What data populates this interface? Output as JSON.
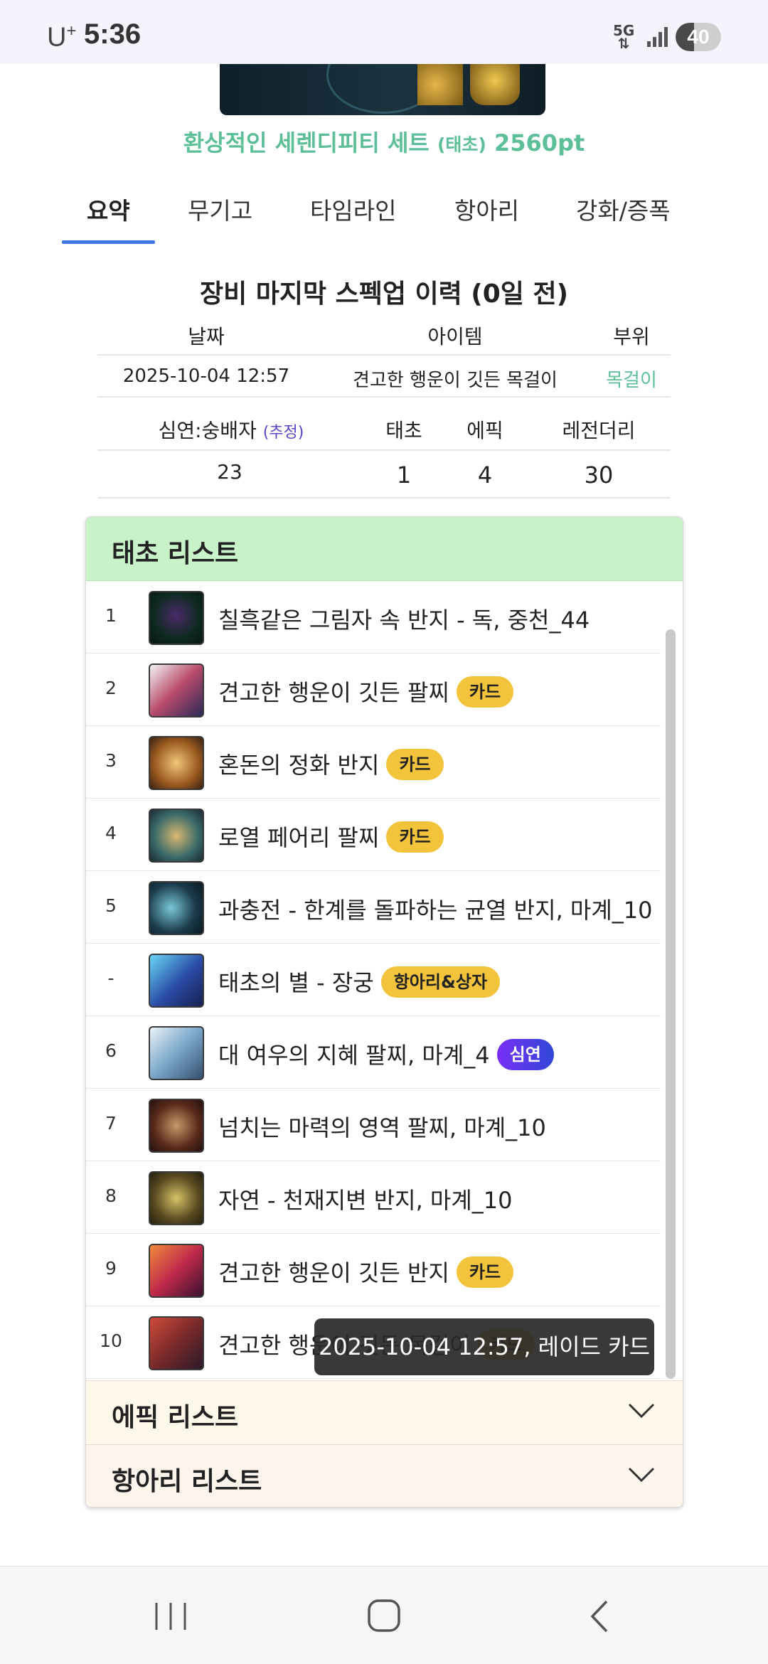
{
  "status_bar": {
    "carrier": "U",
    "carrier_sup": "+",
    "time": "5:36",
    "network": "5G",
    "battery_level": 40,
    "battery_text": "40"
  },
  "banner": {
    "set_name": "환상적인 세렌디피티 세트",
    "set_grade": "(태초)",
    "set_points": "2560pt"
  },
  "tabs": [
    {
      "label": "요약",
      "active": true
    },
    {
      "label": "무기고",
      "active": false
    },
    {
      "label": "타임라인",
      "active": false
    },
    {
      "label": "항아리",
      "active": false
    },
    {
      "label": "강화/증폭",
      "active": false
    }
  ],
  "last_specup": {
    "title": "장비 마지막 스펙업 이력 (0일 전)",
    "headers": {
      "date": "날짜",
      "item": "아이템",
      "slot": "부위"
    },
    "row": {
      "date": "2025-10-04 12:57",
      "item": "견고한 행운이 깃든 목걸이",
      "slot": "목걸이"
    },
    "slot_color": "#5cbf97",
    "stats_headers": {
      "simyeon": "심연:숭배자",
      "estimate": "(추정)",
      "taecho": "태초",
      "epic": "에픽",
      "legendary": "레전더리"
    },
    "stats_values": {
      "simyeon": "23",
      "taecho": "1",
      "epic": "4",
      "legendary": "30"
    }
  },
  "taecho_list": {
    "title": "태초 리스트",
    "items": [
      {
        "idx": "1",
        "name": "칠흑같은 그림자 속 반지 - 독, 중천_44",
        "badge": "",
        "icon": "dark-ring-icon"
      },
      {
        "idx": "2",
        "name": "견고한 행운이 깃든 팔찌",
        "badge": "카드",
        "icon": "lucky-bracelet-icon"
      },
      {
        "idx": "3",
        "name": "혼돈의 정화 반지",
        "badge": "카드",
        "icon": "chaos-ring-icon"
      },
      {
        "idx": "4",
        "name": "로열 페어리 팔찌",
        "badge": "카드",
        "icon": "fairy-bracelet-icon"
      },
      {
        "idx": "5",
        "name": "과충전 - 한계를 돌파하는 균열 반지, 마계_10",
        "badge": "",
        "icon": "overcharge-ring-icon"
      },
      {
        "idx": "-",
        "name": "태초의 별 - 장궁",
        "badge": "항아리&상자",
        "icon": "longbow-icon"
      },
      {
        "idx": "6",
        "name": "대 여우의 지혜 팔찌, 마계_4",
        "badge": "심연",
        "icon": "fox-bracelet-icon"
      },
      {
        "idx": "7",
        "name": "넘치는 마력의 영역 팔찌, 마계_10",
        "badge": "",
        "icon": "mana-bracelet-icon"
      },
      {
        "idx": "8",
        "name": "자연 - 천재지변 반지, 마계_10",
        "badge": "",
        "icon": "nature-ring-icon"
      },
      {
        "idx": "9",
        "name": "견고한 행운이 깃든 반지",
        "badge": "카드",
        "icon": "lucky-ring-icon"
      },
      {
        "idx": "10",
        "name": "견고한 행운이 깃든 목걸이",
        "badge": "카드",
        "icon": "lucky-necklace-icon"
      }
    ]
  },
  "tooltip": "2025-10-04 12:57, 레이드 카드",
  "epic_list": {
    "title": "에픽 리스트"
  },
  "jar_list": {
    "title": "항아리 리스트"
  },
  "colors": {
    "accent": "#3b78e0",
    "taecho_header": "#c8f3c9",
    "epic_header": "#fdf8e8",
    "jar_header": "#fdf4ec",
    "card_badge": "#f4c33c"
  }
}
